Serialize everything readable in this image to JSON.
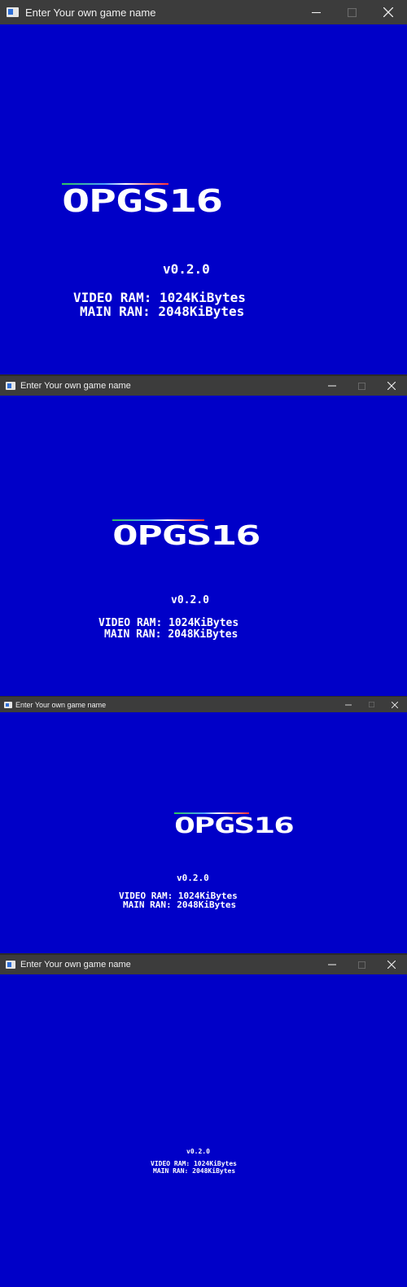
{
  "window_title": "Enter Your own game name",
  "controls": {
    "minimize": "minimize-icon",
    "maximize": "maximize-icon",
    "close": "close-icon"
  },
  "logo_text": "OPGS16",
  "version": "v0.2.0",
  "video_ram": "VIDEO RAM: 1024KiBytes",
  "main_ram": "MAIN RAN: 2048KiBytes",
  "colors": {
    "background": "#0000c8",
    "titlebar": "#3c3c3c",
    "text": "#ffffff"
  }
}
